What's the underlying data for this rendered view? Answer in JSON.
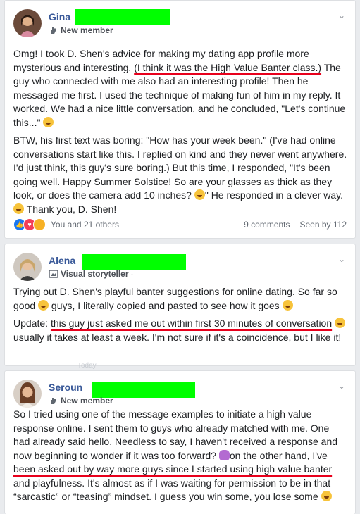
{
  "posts": [
    {
      "author": "Gina",
      "badge": "New member",
      "paragraphs": [
        {
          "before": "Omg! I took D. Shen's advice for making my dating app profile more mysterious and interesting. ",
          "highlight": "(I think it was the High Value Banter class.)",
          "after": " The guy who connected with me also had an interesting profile! Then he messaged me first. I used the technique of making fun of him in my reply. It worked. We had a nice little conversation, and he concluded, \"Let's continue this...\" "
        },
        {
          "text1": "BTW, his first text was boring: \"How has your week been.\" (I've had online conversations start like this. I replied on kind and they never went anywhere. I'd just think, this guy's sure boring.) But this time, I responded, \"It's been going well. Happy Summer Solstice! So are your glasses as thick as they look, or does the camera add 10 inches? ",
          "text2": "\" He responded in a clever way. ",
          "text3": " Thank you, D. Shen!"
        }
      ],
      "reactions_text": "You and 21 others",
      "comments": "9 comments",
      "seen": "Seen by 112"
    },
    {
      "author": "Alena",
      "badge": "Visual storyteller",
      "badge_suffix": "·",
      "p1_a": "Trying out D. Shen's playful banter suggestions for online dating. So far so good ",
      "p1_b": " guys, I literally copied and pasted to see how it goes ",
      "p2_label": "Update: ",
      "p2_highlight": "this guy just asked me out within first 30 minutes of conversation",
      "p2_after": " usually it takes at least a week. I'm not sure if it's a coincidence, but I like it!"
    },
    {
      "author": "Seroun",
      "badge": "New member",
      "p1_a": "So I tried using one of the message examples to initiate a high value response online. I sent them to guys who already matched with me. One had already said hello. Needless to say, I haven't received a response and now beginning to wonder if it was too forward? ",
      "p1_b": "on the other hand, I've ",
      "p1_highlight": "been asked out by way more guys since I started using high value banter",
      "p1_c": " and playfulness. It's almost as if I was waiting for permission to be in that “sarcastic” or “teasing” mindset. I guess you win some, you lose some "
    }
  ],
  "faded_text": "Today",
  "colors": {
    "redaction": "#00ff00",
    "highlight_line": "#e8001c",
    "name": "#385898"
  }
}
